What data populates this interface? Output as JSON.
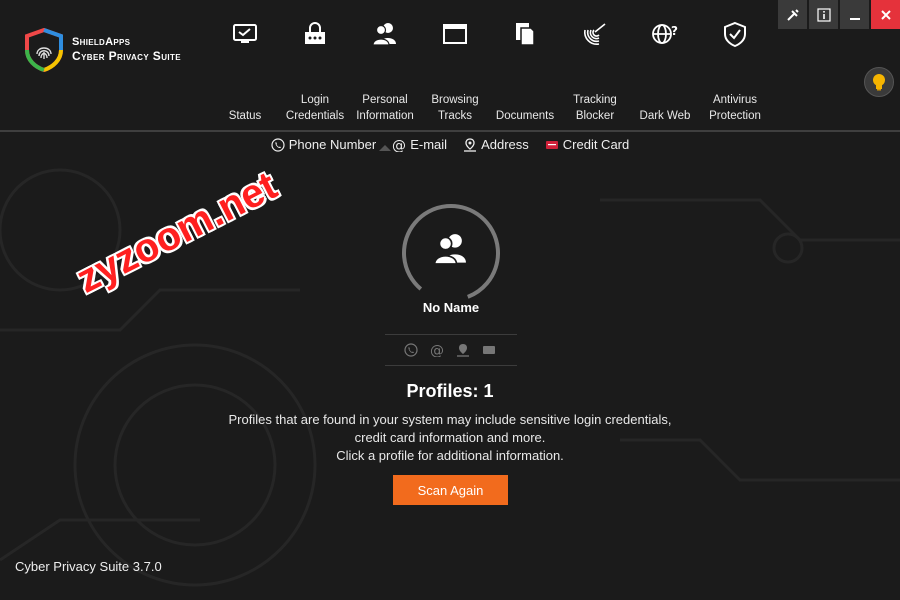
{
  "app": {
    "brand_top": "ShieldApps",
    "brand_bottom": "Cyber Privacy Suite",
    "version": "Cyber Privacy Suite 3.7.0"
  },
  "window_controls": [
    {
      "name": "tools-icon"
    },
    {
      "name": "info-icon"
    },
    {
      "name": "minimize-icon"
    },
    {
      "name": "close-icon"
    }
  ],
  "nav": {
    "items": [
      {
        "label": "Status",
        "icon": "monitor-icon"
      },
      {
        "label": "Login\nCredentials",
        "icon": "login-credentials-icon"
      },
      {
        "label": "Personal\nInformation",
        "icon": "users-icon",
        "active": true
      },
      {
        "label": "Browsing\nTracks",
        "icon": "browser-window-icon"
      },
      {
        "label": "Documents",
        "icon": "documents-icon"
      },
      {
        "label": "Tracking\nBlocker",
        "icon": "radar-icon"
      },
      {
        "label": "Dark Web",
        "icon": "globe-question-icon"
      },
      {
        "label": "Antivirus\nProtection",
        "icon": "shield-check-icon"
      }
    ]
  },
  "subtabs": [
    {
      "label": "Phone Number",
      "icon": "phone-icon"
    },
    {
      "label": "E-mail",
      "icon": "at-icon"
    },
    {
      "label": "Address",
      "icon": "location-icon"
    },
    {
      "label": "Credit Card",
      "icon": "credit-card-icon"
    }
  ],
  "profile": {
    "name": "No Name"
  },
  "summary": {
    "count_label": "Profiles: 1",
    "line1": "Profiles that are found in your system may include sensitive login credentials,",
    "line2": "credit card information and more.",
    "line3": "Click a profile for additional information.",
    "scan_button": "Scan Again"
  },
  "watermark": "zyzoom.net",
  "colors": {
    "accent": "#f26b1d",
    "close": "#e5323b",
    "background": "#1b1b1b",
    "bulb": "#f5b400"
  }
}
